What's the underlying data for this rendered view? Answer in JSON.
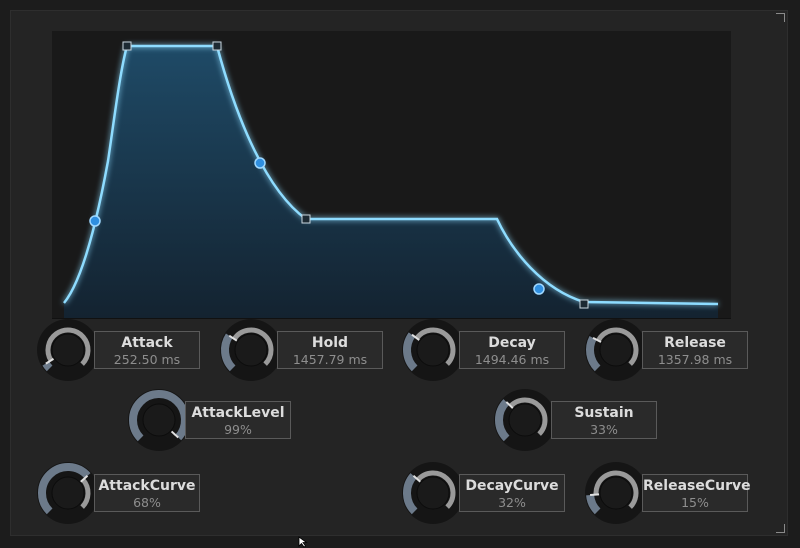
{
  "colors": {
    "envelope_line": "#7fd3ff",
    "envelope_fill_top": "#1f4d6b",
    "handle": "#2f8fe0",
    "knob_track": "#9a9a9a",
    "knob_value": "#6c7a8a"
  },
  "knobs": [
    {
      "id": "attack",
      "name": "Attack",
      "value": "252.50 ms",
      "fraction": 0.05
    },
    {
      "id": "hold",
      "name": "Hold",
      "value": "1457.79 ms",
      "fraction": 0.29
    },
    {
      "id": "decay",
      "name": "Decay",
      "value": "1494.46 ms",
      "fraction": 0.3
    },
    {
      "id": "release",
      "name": "Release",
      "value": "1357.98 ms",
      "fraction": 0.27
    },
    {
      "id": "attacklevel",
      "name": "AttackLevel",
      "value": "99%",
      "fraction": 0.99
    },
    {
      "id": "sustain",
      "name": "Sustain",
      "value": "33%",
      "fraction": 0.33
    },
    {
      "id": "attackcurve",
      "name": "AttackCurve",
      "value": "68%",
      "fraction": 0.68
    },
    {
      "id": "decaycurve",
      "name": "DecayCurve",
      "value": "32%",
      "fraction": 0.32
    },
    {
      "id": "releasecurve",
      "name": "ReleaseCurve",
      "value": "15%",
      "fraction": 0.15
    }
  ]
}
